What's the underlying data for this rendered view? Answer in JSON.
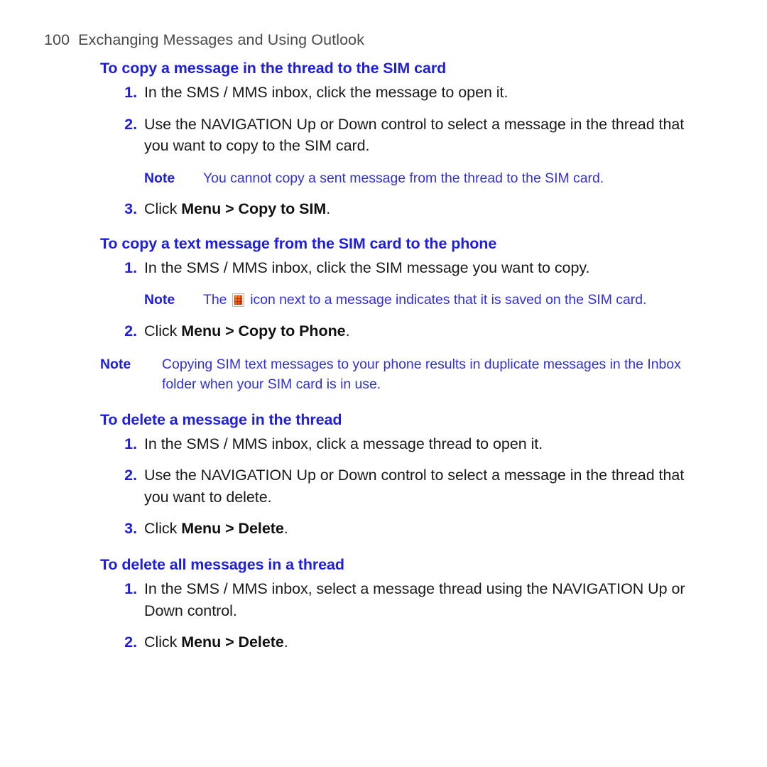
{
  "header": {
    "page_number": "100",
    "chapter_title": "Exchanging Messages and Using Outlook"
  },
  "colors": {
    "heading_blue": "#1f1fdb",
    "note_blue": "#3131dc",
    "header_gray": "#4a4a4a",
    "body_black": "#1a1a1a"
  },
  "sections": [
    {
      "heading": "To copy a message in the thread to the SIM card",
      "steps": [
        {
          "num": "1.",
          "parts": [
            {
              "text": "In the SMS / MMS inbox, click the message to open it.",
              "bold": false
            }
          ]
        },
        {
          "num": "2.",
          "parts": [
            {
              "text": "Use the NAVIGATION Up or Down control to select a message in the thread that you want to copy to the SIM card.",
              "bold": false
            }
          ]
        },
        {
          "num": "3.",
          "parts": [
            {
              "text": "Click ",
              "bold": false
            },
            {
              "text": "Menu > Copy to SIM",
              "bold": true
            },
            {
              "text": ".",
              "bold": false
            }
          ]
        }
      ],
      "note": {
        "label": "Note",
        "text": "You cannot copy a sent message from the thread to the SIM card.",
        "placement": "inner",
        "after_step": "2."
      }
    },
    {
      "heading": "To copy a text message from the SIM card to the phone",
      "steps": [
        {
          "num": "1.",
          "parts": [
            {
              "text": "In the SMS / MMS inbox, click the SIM message you want to copy.",
              "bold": false
            }
          ]
        },
        {
          "num": "2.",
          "parts": [
            {
              "text": "Click ",
              "bold": false
            },
            {
              "text": "Menu > Copy to Phone",
              "bold": true
            },
            {
              "text": ".",
              "bold": false
            }
          ]
        }
      ],
      "note_inner": {
        "label": "Note",
        "text_before_icon": "The ",
        "icon": "sim-card-icon",
        "text_after_icon": " icon next to a message indicates that it is saved on the SIM card.",
        "placement": "inner",
        "after_step": "1."
      },
      "note_outer": {
        "label": "Note",
        "text": "Copying SIM text messages to your phone results in duplicate messages in the Inbox folder when your SIM card is in use.",
        "placement": "outer"
      }
    },
    {
      "heading": "To delete a message in the thread",
      "steps": [
        {
          "num": "1.",
          "parts": [
            {
              "text": "In the SMS / MMS inbox, click a message thread to open it.",
              "bold": false
            }
          ]
        },
        {
          "num": "2.",
          "parts": [
            {
              "text": "Use the NAVIGATION Up or Down control to select a message in the thread that you want to delete.",
              "bold": false
            }
          ]
        },
        {
          "num": "3.",
          "parts": [
            {
              "text": "Click ",
              "bold": false
            },
            {
              "text": "Menu > Delete",
              "bold": true
            },
            {
              "text": ".",
              "bold": false
            }
          ]
        }
      ]
    },
    {
      "heading": "To delete all messages in a thread",
      "steps": [
        {
          "num": "1.",
          "parts": [
            {
              "text": "In the SMS / MMS inbox, select a message thread using the NAVIGATION Up or Down control.",
              "bold": false
            }
          ]
        },
        {
          "num": "2.",
          "parts": [
            {
              "text": "Click ",
              "bold": false
            },
            {
              "text": "Menu > Delete",
              "bold": true
            },
            {
              "text": ".",
              "bold": false
            }
          ]
        }
      ]
    }
  ]
}
